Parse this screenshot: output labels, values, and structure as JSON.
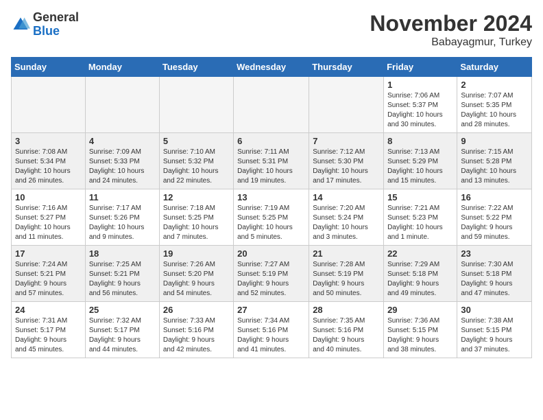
{
  "header": {
    "logo_general": "General",
    "logo_blue": "Blue",
    "month_title": "November 2024",
    "location": "Babayagmur, Turkey"
  },
  "weekdays": [
    "Sunday",
    "Monday",
    "Tuesday",
    "Wednesday",
    "Thursday",
    "Friday",
    "Saturday"
  ],
  "weeks": [
    [
      {
        "day": "",
        "info": ""
      },
      {
        "day": "",
        "info": ""
      },
      {
        "day": "",
        "info": ""
      },
      {
        "day": "",
        "info": ""
      },
      {
        "day": "",
        "info": ""
      },
      {
        "day": "1",
        "info": "Sunrise: 7:06 AM\nSunset: 5:37 PM\nDaylight: 10 hours\nand 30 minutes."
      },
      {
        "day": "2",
        "info": "Sunrise: 7:07 AM\nSunset: 5:35 PM\nDaylight: 10 hours\nand 28 minutes."
      }
    ],
    [
      {
        "day": "3",
        "info": "Sunrise: 7:08 AM\nSunset: 5:34 PM\nDaylight: 10 hours\nand 26 minutes."
      },
      {
        "day": "4",
        "info": "Sunrise: 7:09 AM\nSunset: 5:33 PM\nDaylight: 10 hours\nand 24 minutes."
      },
      {
        "day": "5",
        "info": "Sunrise: 7:10 AM\nSunset: 5:32 PM\nDaylight: 10 hours\nand 22 minutes."
      },
      {
        "day": "6",
        "info": "Sunrise: 7:11 AM\nSunset: 5:31 PM\nDaylight: 10 hours\nand 19 minutes."
      },
      {
        "day": "7",
        "info": "Sunrise: 7:12 AM\nSunset: 5:30 PM\nDaylight: 10 hours\nand 17 minutes."
      },
      {
        "day": "8",
        "info": "Sunrise: 7:13 AM\nSunset: 5:29 PM\nDaylight: 10 hours\nand 15 minutes."
      },
      {
        "day": "9",
        "info": "Sunrise: 7:15 AM\nSunset: 5:28 PM\nDaylight: 10 hours\nand 13 minutes."
      }
    ],
    [
      {
        "day": "10",
        "info": "Sunrise: 7:16 AM\nSunset: 5:27 PM\nDaylight: 10 hours\nand 11 minutes."
      },
      {
        "day": "11",
        "info": "Sunrise: 7:17 AM\nSunset: 5:26 PM\nDaylight: 10 hours\nand 9 minutes."
      },
      {
        "day": "12",
        "info": "Sunrise: 7:18 AM\nSunset: 5:25 PM\nDaylight: 10 hours\nand 7 minutes."
      },
      {
        "day": "13",
        "info": "Sunrise: 7:19 AM\nSunset: 5:25 PM\nDaylight: 10 hours\nand 5 minutes."
      },
      {
        "day": "14",
        "info": "Sunrise: 7:20 AM\nSunset: 5:24 PM\nDaylight: 10 hours\nand 3 minutes."
      },
      {
        "day": "15",
        "info": "Sunrise: 7:21 AM\nSunset: 5:23 PM\nDaylight: 10 hours\nand 1 minute."
      },
      {
        "day": "16",
        "info": "Sunrise: 7:22 AM\nSunset: 5:22 PM\nDaylight: 9 hours\nand 59 minutes."
      }
    ],
    [
      {
        "day": "17",
        "info": "Sunrise: 7:24 AM\nSunset: 5:21 PM\nDaylight: 9 hours\nand 57 minutes."
      },
      {
        "day": "18",
        "info": "Sunrise: 7:25 AM\nSunset: 5:21 PM\nDaylight: 9 hours\nand 56 minutes."
      },
      {
        "day": "19",
        "info": "Sunrise: 7:26 AM\nSunset: 5:20 PM\nDaylight: 9 hours\nand 54 minutes."
      },
      {
        "day": "20",
        "info": "Sunrise: 7:27 AM\nSunset: 5:19 PM\nDaylight: 9 hours\nand 52 minutes."
      },
      {
        "day": "21",
        "info": "Sunrise: 7:28 AM\nSunset: 5:19 PM\nDaylight: 9 hours\nand 50 minutes."
      },
      {
        "day": "22",
        "info": "Sunrise: 7:29 AM\nSunset: 5:18 PM\nDaylight: 9 hours\nand 49 minutes."
      },
      {
        "day": "23",
        "info": "Sunrise: 7:30 AM\nSunset: 5:18 PM\nDaylight: 9 hours\nand 47 minutes."
      }
    ],
    [
      {
        "day": "24",
        "info": "Sunrise: 7:31 AM\nSunset: 5:17 PM\nDaylight: 9 hours\nand 45 minutes."
      },
      {
        "day": "25",
        "info": "Sunrise: 7:32 AM\nSunset: 5:17 PM\nDaylight: 9 hours\nand 44 minutes."
      },
      {
        "day": "26",
        "info": "Sunrise: 7:33 AM\nSunset: 5:16 PM\nDaylight: 9 hours\nand 42 minutes."
      },
      {
        "day": "27",
        "info": "Sunrise: 7:34 AM\nSunset: 5:16 PM\nDaylight: 9 hours\nand 41 minutes."
      },
      {
        "day": "28",
        "info": "Sunrise: 7:35 AM\nSunset: 5:16 PM\nDaylight: 9 hours\nand 40 minutes."
      },
      {
        "day": "29",
        "info": "Sunrise: 7:36 AM\nSunset: 5:15 PM\nDaylight: 9 hours\nand 38 minutes."
      },
      {
        "day": "30",
        "info": "Sunrise: 7:38 AM\nSunset: 5:15 PM\nDaylight: 9 hours\nand 37 minutes."
      }
    ]
  ]
}
